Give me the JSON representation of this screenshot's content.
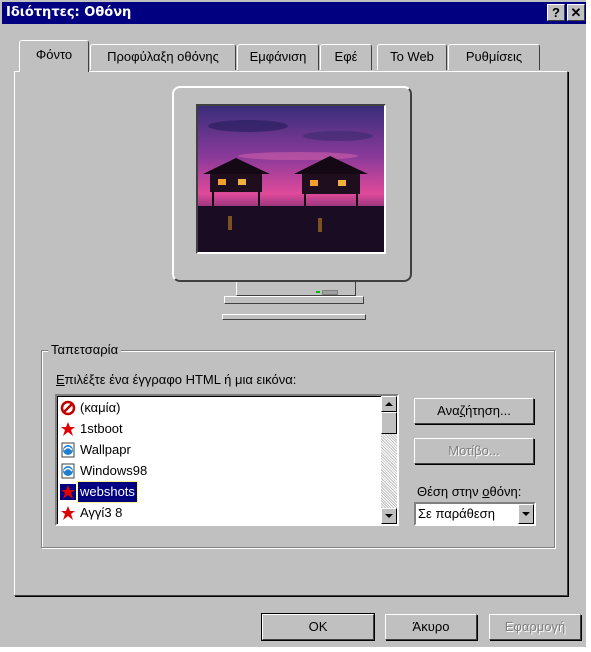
{
  "window": {
    "title": "Ιδιότητες: Οθόνη",
    "help_button": "?",
    "close_button": "✕"
  },
  "tabs": [
    {
      "label": "Φόντο",
      "active": true
    },
    {
      "label": "Προφύλαξη οθόνης",
      "active": false
    },
    {
      "label": "Εμφάνιση",
      "active": false
    },
    {
      "label": "Εφέ",
      "active": false
    },
    {
      "label": "Το Web",
      "active": false
    },
    {
      "label": "Ρυθμίσεις",
      "active": false
    }
  ],
  "wallpaper": {
    "group_label": "Ταπετσαρία",
    "list_label_pre": "Ε",
    "list_label_rest": "πιλέξτε ένα έγγραφο HTML ή μια εικόνα:",
    "items": [
      {
        "label": "(καμία)",
        "icon": "none-icon"
      },
      {
        "label": "1stboot",
        "icon": "paint-image-icon"
      },
      {
        "label": "Wallpapr",
        "icon": "html-document-icon"
      },
      {
        "label": "Windows98",
        "icon": "html-document-icon"
      },
      {
        "label": "webshots",
        "icon": "paint-image-icon",
        "selected": true
      },
      {
        "label": "Αγγί3 8",
        "icon": "paint-image-icon"
      }
    ],
    "browse_pre": "Ανα",
    "browse_u": "ζ",
    "browse_post": "ήτηση...",
    "pattern_label": "Μοτίβο...",
    "position_pre": "Θέση στην ",
    "position_u": "ο",
    "position_post": "θόνη:",
    "position_value": "Σε παράθεση"
  },
  "footer": {
    "ok": "OK",
    "cancel": "Άκυρο",
    "apply": "Εφαρμογή"
  },
  "colors": {
    "title_bar": "#000080",
    "face": "#c0c0c0",
    "selection": "#000080"
  }
}
